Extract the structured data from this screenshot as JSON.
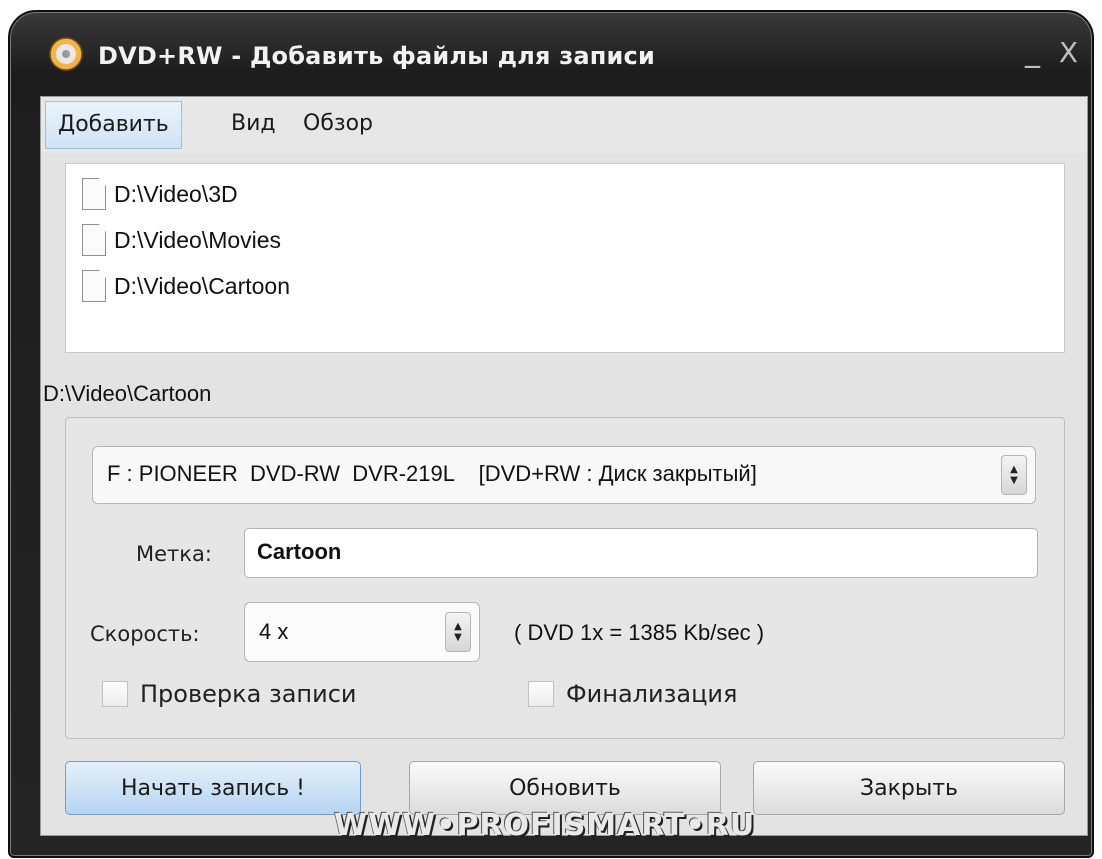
{
  "window": {
    "title": "DVD+RW - Добавить файлы для записи",
    "minimize_glyph": "_",
    "close_glyph": "X"
  },
  "menu": {
    "items": [
      {
        "label": "Добавить",
        "active": true
      },
      {
        "label": "Вид"
      },
      {
        "label": "Обзор"
      }
    ]
  },
  "file_list": {
    "items": [
      {
        "path": "D:\\Video\\3D",
        "icon": "file-icon"
      },
      {
        "path": "D:\\Video\\Movies",
        "icon": "file-icon"
      },
      {
        "path": "D:\\Video\\Cartoon",
        "icon": "file-icon"
      }
    ],
    "selected_path": "D:\\Video\\Cartoon"
  },
  "settings": {
    "drive": "F : PIONEER  DVD-RW  DVR-219L    [DVD+RW : Диск закрытый]",
    "label_caption": "Метка:",
    "label_value": "Cartoon",
    "speed_caption": "Скорость:",
    "speed_value": "4 x",
    "speed_note": "( DVD 1x = 1385 Kb/sec )",
    "verify_label": "Проверка записи",
    "finalize_label": "Финализация"
  },
  "buttons": {
    "start": "Начать запись !",
    "refresh": "Обновить",
    "close": "Закрыть"
  },
  "watermark": "WWW•PROFISMART•RU",
  "colors": {
    "titlebar": "#1d1d1d",
    "client_bg": "#e3e3e3",
    "start_button": "#b6d4f0",
    "active_menu": "#cfe3f7"
  }
}
